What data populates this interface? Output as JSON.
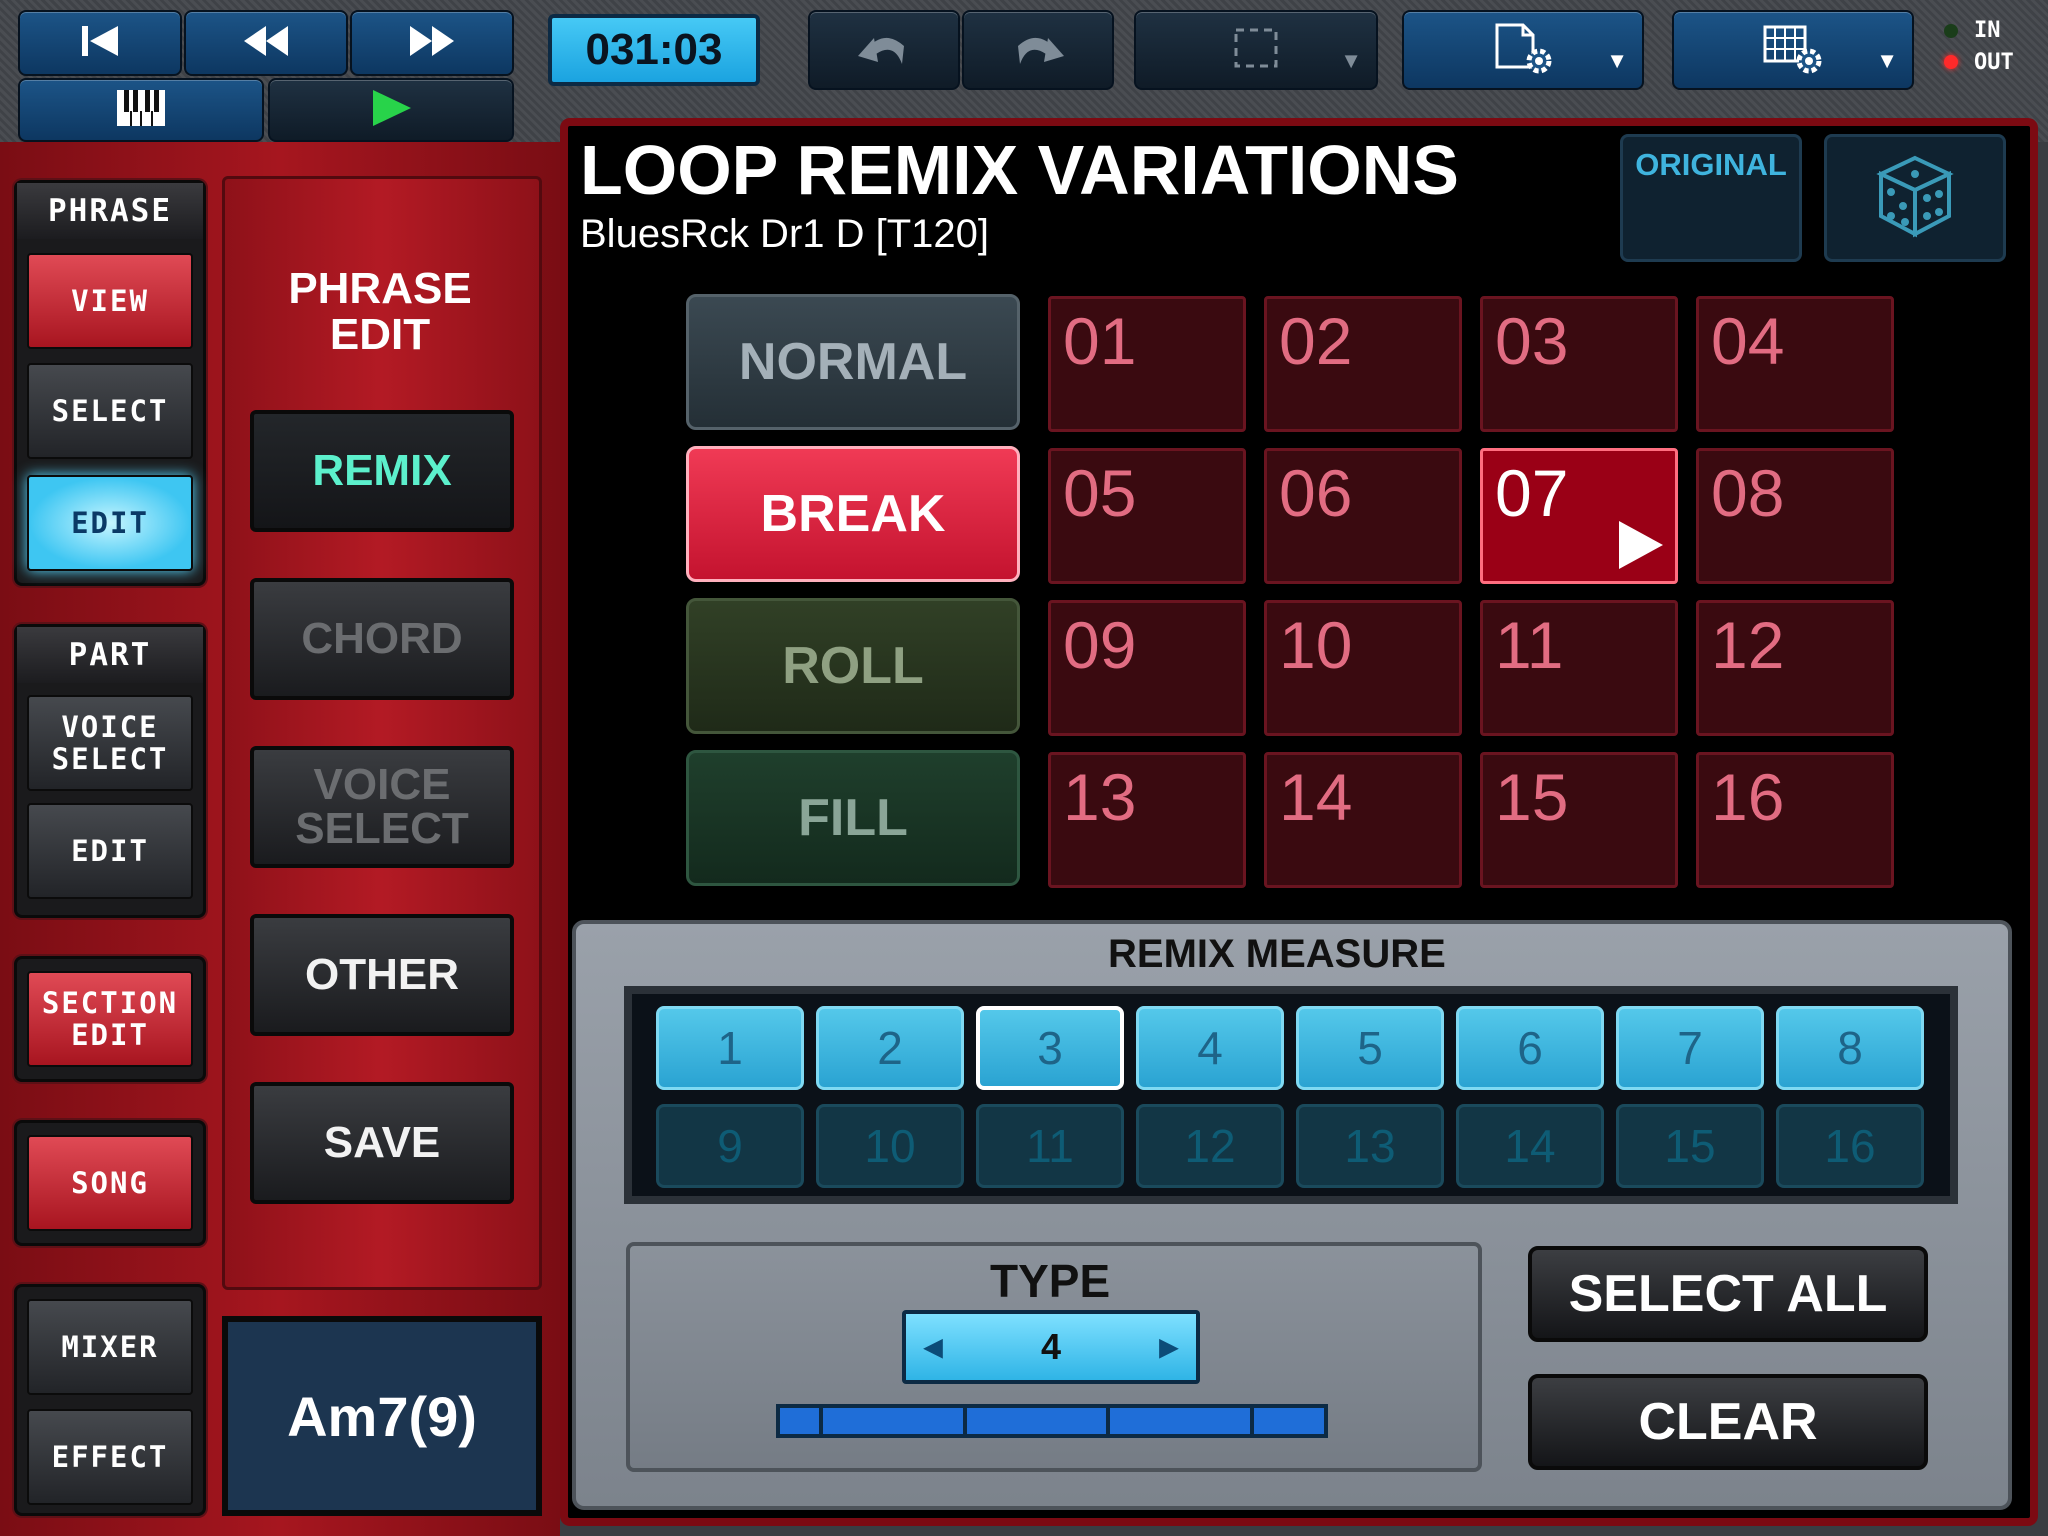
{
  "transport": {
    "time": "031:03",
    "io": {
      "in_label": "IN",
      "out_label": "OUT"
    }
  },
  "icons": [
    "skip-back-icon",
    "rewind-icon",
    "fast-forward-icon",
    "piano-keyboard-icon",
    "play-icon",
    "undo-icon",
    "redo-icon",
    "selection-icon",
    "file-settings-icon",
    "grid-settings-icon",
    "dice-icon"
  ],
  "nav": {
    "phrase": {
      "header": "PHRASE",
      "view": "VIEW",
      "select": "SELECT",
      "edit": "EDIT"
    },
    "part": {
      "header": "PART",
      "voice_select": "VOICE SELECT",
      "edit": "EDIT"
    },
    "section_edit": "SECTION EDIT",
    "song": "SONG",
    "mixer": "MIXER",
    "effect": "EFFECT"
  },
  "phrase_edit": {
    "title": "PHRASE EDIT",
    "buttons": {
      "remix": "REMIX",
      "chord": "CHORD",
      "voice_select": "VOICE SELECT",
      "other": "OTHER",
      "save": "SAVE"
    },
    "chord": "Am7(9)"
  },
  "main": {
    "title": "LOOP REMIX VARIATIONS",
    "subtitle": "BluesRck Dr1 D [T120]",
    "original_label": "ORIGINAL",
    "categories": {
      "normal": "NORMAL",
      "break": "BREAK",
      "roll": "ROLL",
      "fill": "FILL"
    },
    "selected_category": "BREAK",
    "variations": [
      "01",
      "02",
      "03",
      "04",
      "05",
      "06",
      "07",
      "08",
      "09",
      "10",
      "11",
      "12",
      "13",
      "14",
      "15",
      "16"
    ],
    "active_variation": "07"
  },
  "remix_measure": {
    "title": "REMIX MEASURE",
    "measures": [
      "1",
      "2",
      "3",
      "4",
      "5",
      "6",
      "7",
      "8",
      "9",
      "10",
      "11",
      "12",
      "13",
      "14",
      "15",
      "16"
    ],
    "active_measures": 8,
    "selected_measure": "3"
  },
  "type": {
    "label": "TYPE",
    "value": "4"
  },
  "actions": {
    "select_all": "SELECT ALL",
    "clear": "CLEAR"
  },
  "colors": {
    "accent_red": "#c4132f",
    "accent_cyan": "#3ec6f2",
    "remix_text": "#5cf0cc"
  }
}
